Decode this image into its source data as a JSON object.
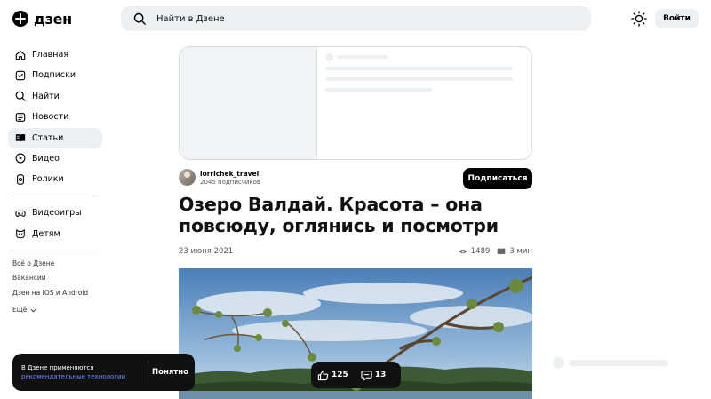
{
  "header": {
    "logo_text": "дзен",
    "search_placeholder": "Найти в Дзене",
    "login_label": "Войти"
  },
  "sidebar": {
    "items": [
      {
        "label": "Главная",
        "icon": "home-icon"
      },
      {
        "label": "Подписки",
        "icon": "subscriptions-icon"
      },
      {
        "label": "Найти",
        "icon": "search-icon"
      },
      {
        "label": "Новости",
        "icon": "news-icon"
      },
      {
        "label": "Статьи",
        "icon": "articles-icon",
        "active": true
      },
      {
        "label": "Видео",
        "icon": "video-icon"
      },
      {
        "label": "Ролики",
        "icon": "shorts-icon"
      }
    ],
    "secondary": [
      {
        "label": "Видеоигры",
        "icon": "gamepad-icon"
      },
      {
        "label": "Детям",
        "icon": "kids-icon"
      }
    ],
    "footer_links": [
      "Всё о Дзене",
      "Вакансии",
      "Дзен на IOS и Android"
    ],
    "more_label": "Ещё"
  },
  "article": {
    "author_name": "lorrichek_travel",
    "author_subscribers": "2045 подписчиков",
    "subscribe_label": "Подписаться",
    "title": "Озеро Валдай. Красота – она повсюду, оглянись и посмотри",
    "date": "23 июня 2021",
    "views": "1489",
    "read_time": "3 мин"
  },
  "reactions": {
    "likes": "125",
    "comments": "13"
  },
  "cookie": {
    "text": "В Дзене применяются",
    "link": "рекомендательные технологии",
    "button": "Понятно"
  },
  "colors": {
    "accent_link": "#6d8bff",
    "surface": "#eeeff2",
    "dark": "#111111"
  }
}
